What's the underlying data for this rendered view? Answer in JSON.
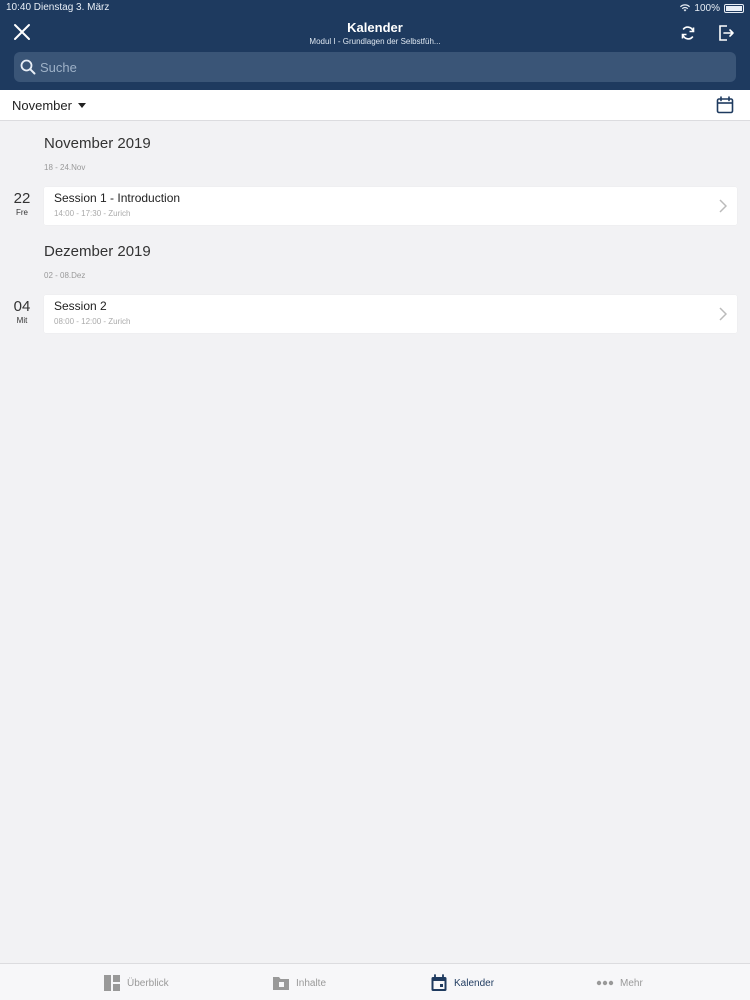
{
  "status": {
    "time_date": "10:40  Dienstag 3. März",
    "battery": "100%"
  },
  "header": {
    "title": "Kalender",
    "subtitle": "Modul I - Grundlagen der Selbstfüh..."
  },
  "search": {
    "placeholder": "Suche",
    "value": ""
  },
  "month_selector": {
    "label": "November"
  },
  "sections": [
    {
      "heading": "November 2019",
      "week_range": "18 - 24.Nov",
      "day_num": "22",
      "day_name": "Fre",
      "event_title": "Session 1 - Introduction",
      "event_meta": "14:00 - 17:30 - Zurich"
    },
    {
      "heading": "Dezember 2019",
      "week_range": "02 - 08.Dez",
      "day_num": "04",
      "day_name": "Mit",
      "event_title": "Session 2",
      "event_meta": "08:00 - 12:00 - Zurich"
    }
  ],
  "tabs": [
    {
      "label": "Überblick",
      "icon": "dashboard-icon",
      "active": false
    },
    {
      "label": "Inhalte",
      "icon": "folder-icon",
      "active": false
    },
    {
      "label": "Kalender",
      "icon": "calendar-icon",
      "active": true
    },
    {
      "label": "Mehr",
      "icon": "more-dots-icon",
      "active": false
    }
  ],
  "colors": {
    "header_bg": "#1e3a5f",
    "search_bg": "#3a5577",
    "page_bg": "#f2f2f4",
    "active_tab": "#1e3a5f"
  }
}
